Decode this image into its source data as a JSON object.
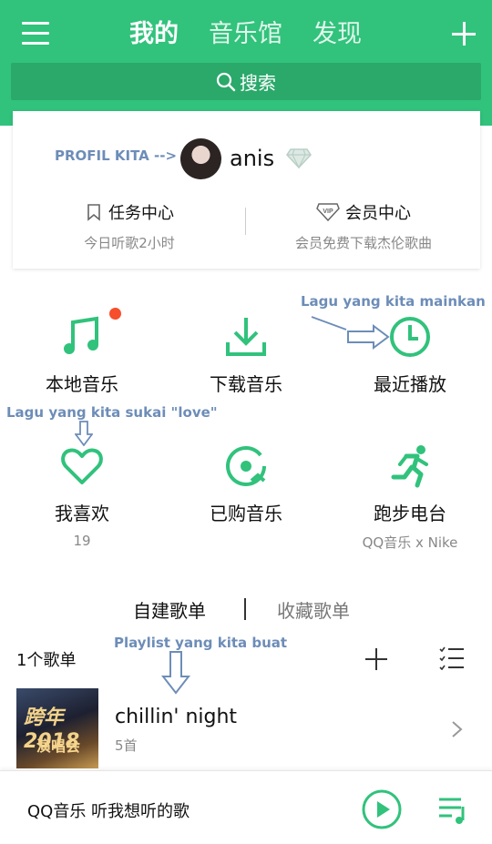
{
  "header": {
    "tabs": [
      "我的",
      "音乐馆",
      "发现"
    ],
    "search_label": "搜索"
  },
  "profile": {
    "annotation": "PROFIL KITA -->",
    "username": "anis",
    "task_center": {
      "title": "任务中心",
      "sub": "今日听歌2小时"
    },
    "vip_center": {
      "title": "会员中心",
      "sub": "会员免费下载杰伦歌曲"
    }
  },
  "grid": [
    {
      "label": "本地音乐",
      "icon": "music-note-icon"
    },
    {
      "label": "下载音乐",
      "icon": "download-icon"
    },
    {
      "label": "最近播放",
      "icon": "clock-icon"
    },
    {
      "label": "我喜欢",
      "sub": "19",
      "icon": "heart-icon"
    },
    {
      "label": "已购音乐",
      "icon": "purchased-disc-icon"
    },
    {
      "label": "跑步电台",
      "sub": "QQ音乐 x Nike",
      "icon": "runner-icon"
    }
  ],
  "annotations": {
    "recent": "Lagu yang kita mainkan",
    "love": "Lagu yang kita sukai \"love\"",
    "playlist": "Playlist yang kita buat"
  },
  "playlist_tabs": {
    "created": "自建歌单",
    "collected": "收藏歌单"
  },
  "playlist_section": {
    "count_label": "1个歌单"
  },
  "playlists": [
    {
      "cover_text": "跨年 2018",
      "cover_sub": "演唱会",
      "title": "chillin' night",
      "count": "5首"
    }
  ],
  "player": {
    "text": "QQ音乐 听我想听的歌"
  },
  "colors": {
    "brand": "#31c27c",
    "search_bg": "#2aa96a",
    "annotation": "#6d8db8",
    "badge": "#f74e2b"
  }
}
